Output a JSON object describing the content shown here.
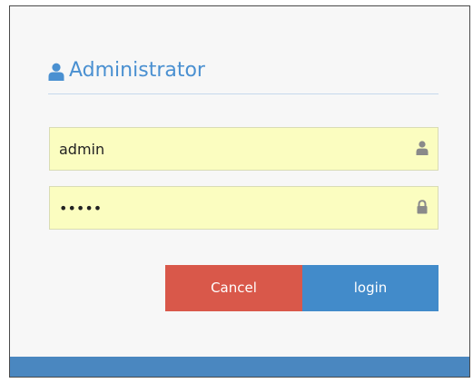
{
  "panel": {
    "title": "Administrator",
    "title_icon": "user-icon"
  },
  "username": {
    "value": "admin",
    "icon": "user-icon"
  },
  "password": {
    "value": "admin",
    "icon": "lock-icon"
  },
  "buttons": {
    "cancel_label": "Cancel",
    "login_label": "login"
  },
  "colors": {
    "accent": "#4a90d1",
    "field_background": "#fbfdc0",
    "cancel_button": "#d9584a",
    "login_button": "#428bca",
    "footer": "#4a87c0"
  }
}
